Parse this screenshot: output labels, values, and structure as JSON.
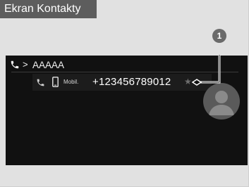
{
  "title": "Ekran Kontakty",
  "callout_number": "1",
  "header": {
    "icon": "phone-icon",
    "chevron": ">",
    "name": "AAAAA"
  },
  "entry": {
    "call_icon": "phone-icon",
    "device_icon": "mobile-phone-icon",
    "type_label": "Mobil.",
    "number": "+123456789012",
    "favorite_icon": "star-icon"
  },
  "avatar_icon": "person-silhouette-icon",
  "colors": {
    "screen_bg": "#111111",
    "frame_bg": "#e1e1e1",
    "title_bg": "#5d5d5d",
    "badge_bg": "#6a6a6a",
    "text": "#ffffff"
  }
}
